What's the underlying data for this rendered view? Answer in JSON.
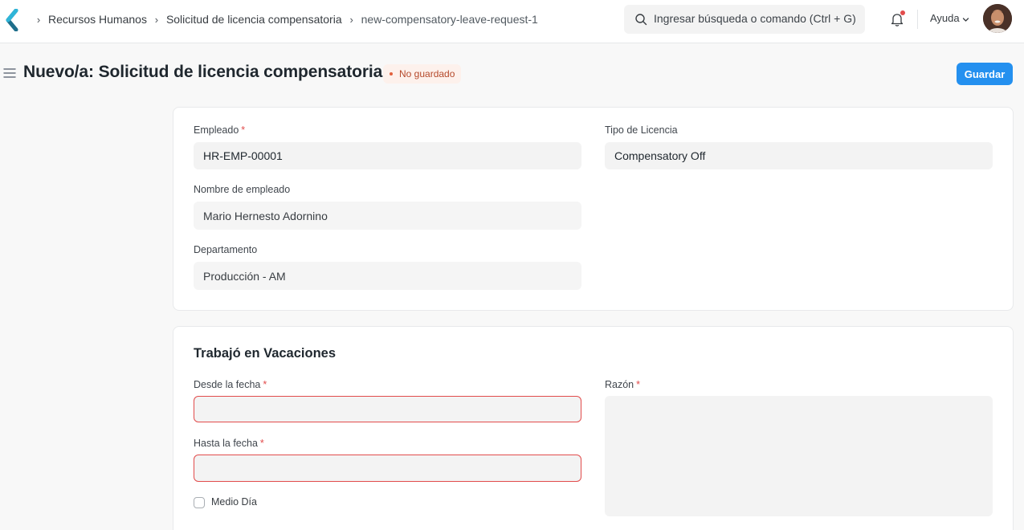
{
  "navbar": {
    "breadcrumbs": [
      "Recursos Humanos",
      "Solicitud de licencia compensatoria",
      "new-compensatory-leave-request-1"
    ],
    "search_placeholder": "Ingresar búsqueda o comando (Ctrl + G)",
    "help_label": "Ayuda",
    "icons": [
      "back-logo-icon",
      "search-icon",
      "bell-icon",
      "chevron-down-icon",
      "avatar"
    ]
  },
  "page": {
    "title": "Nuevo/a: Solicitud de licencia compensatoria",
    "status_badge": "No guardado",
    "save_label": "Guardar"
  },
  "form": {
    "employee": {
      "label": "Empleado",
      "value": "HR-EMP-00001",
      "required": "*"
    },
    "leave_type": {
      "label": "Tipo de Licencia",
      "value": "Compensatory Off"
    },
    "employee_name": {
      "label": "Nombre de empleado",
      "value": "Mario Hernesto Adornino"
    },
    "department": {
      "label": "Departamento",
      "value": "Producción - AM"
    }
  },
  "worked_holidays": {
    "section_title": "Trabajó en Vacaciones",
    "from_date": {
      "label": "Desde la fecha",
      "value": "",
      "required": "*"
    },
    "to_date": {
      "label": "Hasta la fecha",
      "value": "",
      "required": "*"
    },
    "half_day": {
      "label": "Medio Día",
      "checked": false
    },
    "reason": {
      "label": "Razón",
      "value": "",
      "required": "*"
    }
  },
  "colors": {
    "primary": "#2490ef",
    "error": "#e24c4c",
    "badge_bg": "#fdf1ec",
    "badge_text": "#b5492b"
  }
}
